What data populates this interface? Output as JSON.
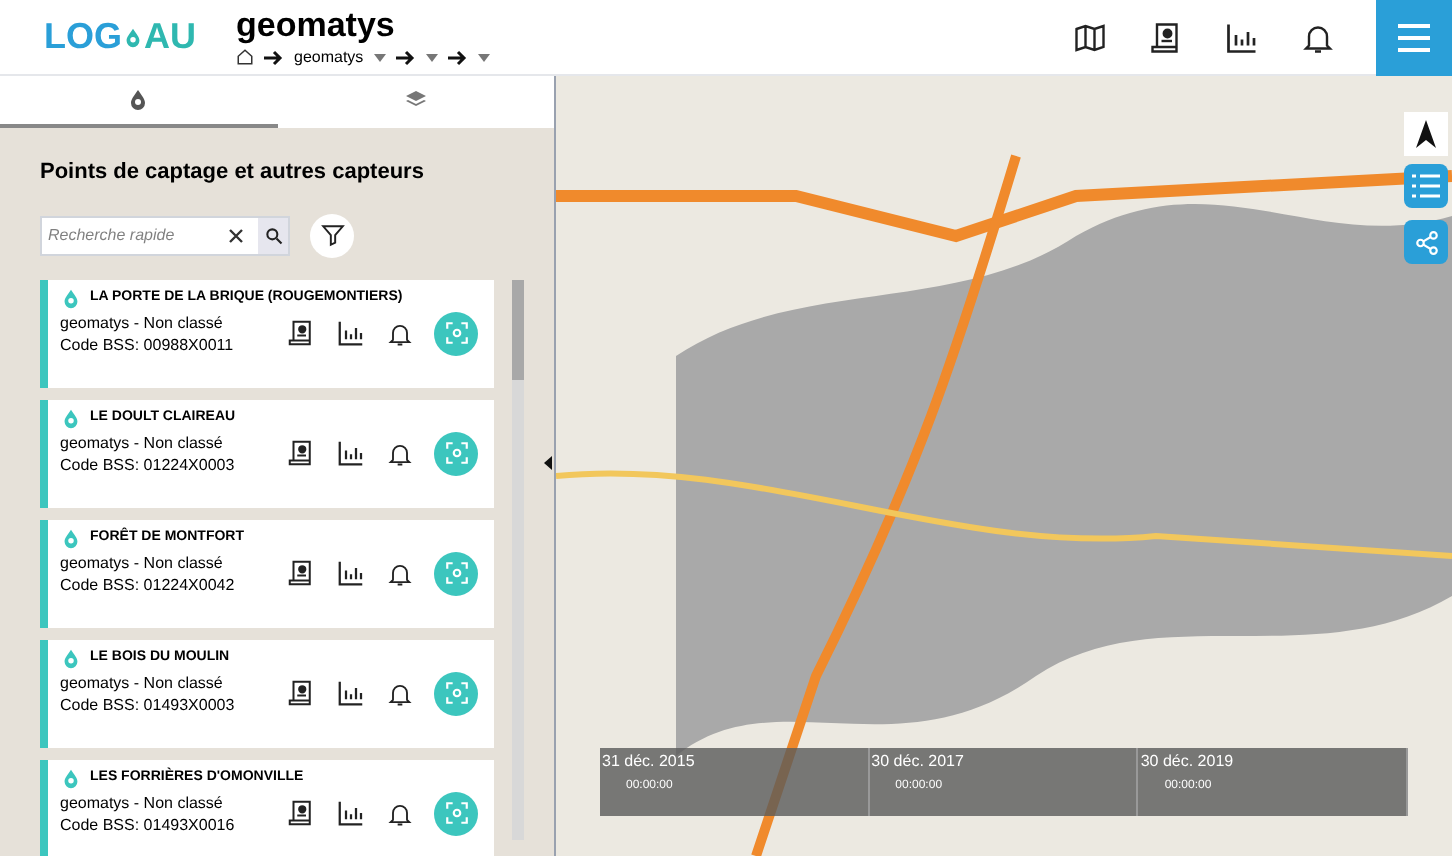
{
  "header": {
    "logo": {
      "left": "LOG",
      "right": "AU"
    },
    "title": "geomatys",
    "breadcrumb": [
      {
        "kind": "named",
        "label": "geomatys"
      },
      {
        "kind": "blank"
      },
      {
        "kind": "blank"
      }
    ]
  },
  "tabs": [
    {
      "kind": "sensors",
      "selected": true
    },
    {
      "kind": "layers",
      "selected": false
    }
  ],
  "panel": {
    "title": "Points de captage et autres capteurs",
    "search": {
      "placeholder": "Recherche rapide"
    },
    "stations": [
      {
        "name": "LA PORTE DE LA BRIQUE (ROUGEMONTIERS)",
        "owner": "geomatys - Non classé",
        "code": "Code BSS: 00988X0011"
      },
      {
        "name": "LE DOULT CLAIREAU",
        "owner": "geomatys - Non classé",
        "code": "Code BSS: 01224X0003"
      },
      {
        "name": "FORÊT DE MONTFORT",
        "owner": "geomatys - Non classé",
        "code": "Code BSS: 01224X0042"
      },
      {
        "name": "LE BOIS DU MOULIN",
        "owner": "geomatys - Non classé",
        "code": "Code BSS: 01493X0003"
      },
      {
        "name": "LES FORRIÈRES D'OMONVILLE",
        "owner": "geomatys - Non classé",
        "code": "Code BSS: 01493X0016"
      }
    ]
  },
  "timeline": {
    "marks": [
      {
        "date": "31 déc. 2015",
        "time": "00:00:00"
      },
      {
        "date": "30 déc. 2017",
        "time": "00:00:00"
      },
      {
        "date": "30 déc. 2019",
        "time": "00:00:00"
      }
    ]
  }
}
